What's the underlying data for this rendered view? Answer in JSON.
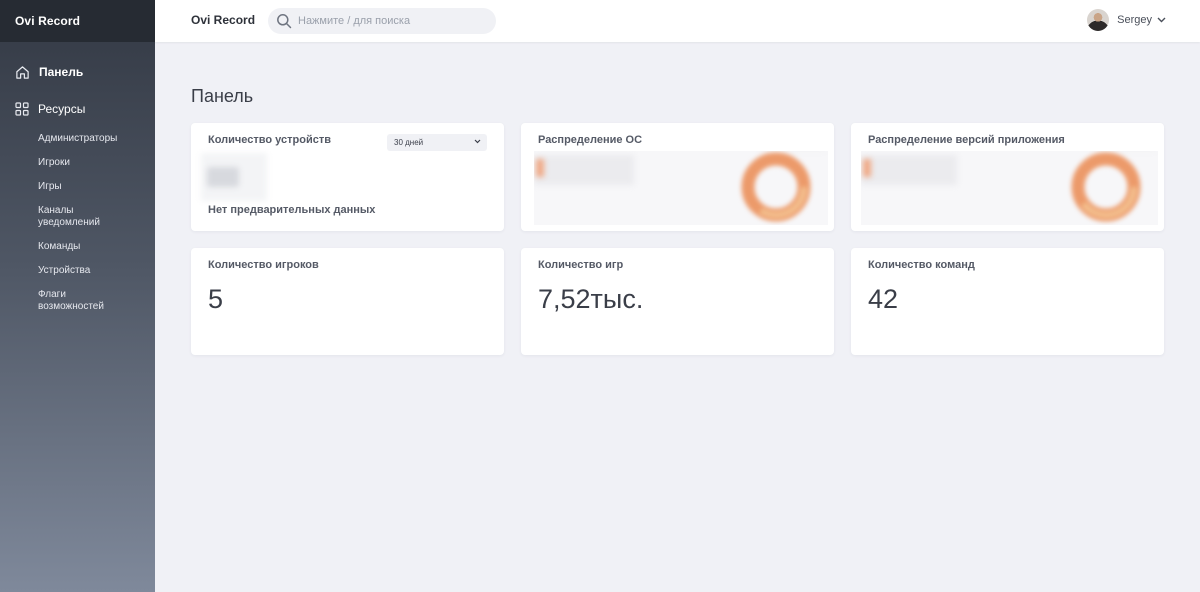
{
  "app": {
    "brand": "Ovi Record",
    "top_title": "Ovi Record"
  },
  "search": {
    "placeholder": "Нажмите / для поиска"
  },
  "user": {
    "name": "Sergey"
  },
  "sidebar": {
    "panel_label": "Панель",
    "resources_label": "Ресурсы",
    "resources": [
      "Администраторы",
      "Игроки",
      "Игры",
      "Каналы уведомлений",
      "Команды",
      "Устройства",
      "Флаги возможностей"
    ]
  },
  "page": {
    "title": "Панель"
  },
  "cards": {
    "devices": {
      "title": "Количество устройств",
      "range": "30 дней",
      "empty": "Нет предварительных данных"
    },
    "os": {
      "title": "Распределение ОС"
    },
    "versions": {
      "title": "Распределение версий приложения"
    },
    "players": {
      "title": "Количество игроков",
      "value": "5"
    },
    "games": {
      "title": "Количество игр",
      "value": "7,52тыс."
    },
    "teams": {
      "title": "Количество команд",
      "value": "42"
    }
  },
  "colors": {
    "sidebar_top": "#333944",
    "sidebar_bottom": "#7f899b",
    "donut_outer": "#ec9a6a",
    "donut_inner": "#f3c08f"
  }
}
